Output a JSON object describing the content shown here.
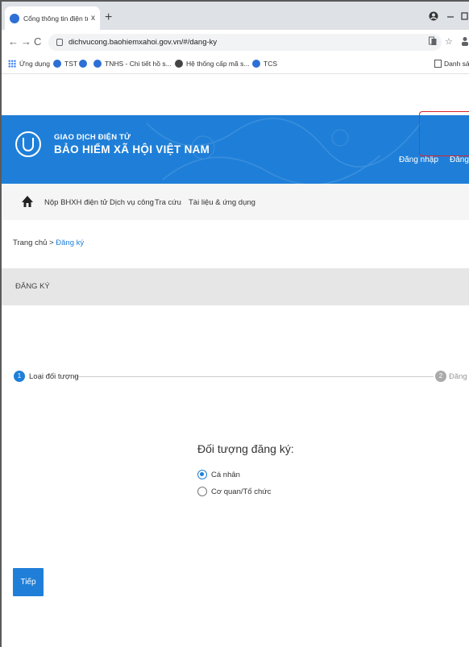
{
  "browser": {
    "tab_title": "Cổng thông tin điện tử - Bảo hiể",
    "tab_close": "x",
    "new_tab": "+",
    "url": "dichvucong.baohiemxahoi.gov.vn/#/dang-ky",
    "bookmarks": [
      {
        "label": "Ứng dụng",
        "icon": "apps-grid-icon",
        "color": "#4285f4"
      },
      {
        "label": "TST",
        "icon": "globe-icon",
        "color": "#2d6fd6"
      },
      {
        "label": "",
        "icon": "globe-icon",
        "color": "#2d6fd6"
      },
      {
        "label": "TNHS - Chi tiết hồ s...",
        "icon": "globe-icon",
        "color": "#2d6fd6"
      },
      {
        "label": "Hệ thống cấp mã s...",
        "icon": "settings-icon",
        "color": "#444444"
      },
      {
        "label": "TCS",
        "icon": "globe-icon",
        "color": "#2d6fd6"
      }
    ],
    "reading_list": "Danh sác"
  },
  "header": {
    "brand_top": "GIAO DỊCH ĐIỆN TỬ",
    "brand_main": "BẢO HIỂM XÃ HỘI VIỆT NAM",
    "login": "Đăng nhập",
    "register": "Đăng ký",
    "color": "#1f7fd8"
  },
  "menu": {
    "items": [
      "Nộp BHXH điện tử",
      "Dịch vụ công",
      "Tra cứu",
      "Tài liệu & ứng dụng"
    ]
  },
  "breadcrumb": {
    "home": "Trang chủ",
    "sep": ">",
    "current": "Đăng ký"
  },
  "page_title": "ĐĂNG KÝ",
  "stepper": {
    "steps": [
      {
        "number": "1",
        "label": "Loại đối tượng",
        "active": true
      },
      {
        "number": "2",
        "label": "Đăng ký",
        "active": false
      }
    ]
  },
  "form": {
    "title": "Đối tượng đăng ký:",
    "options": [
      {
        "label": "Cá nhân",
        "checked": true
      },
      {
        "label": "Cơ quan/Tổ chức",
        "checked": false
      }
    ]
  },
  "next_button": "Tiếp"
}
